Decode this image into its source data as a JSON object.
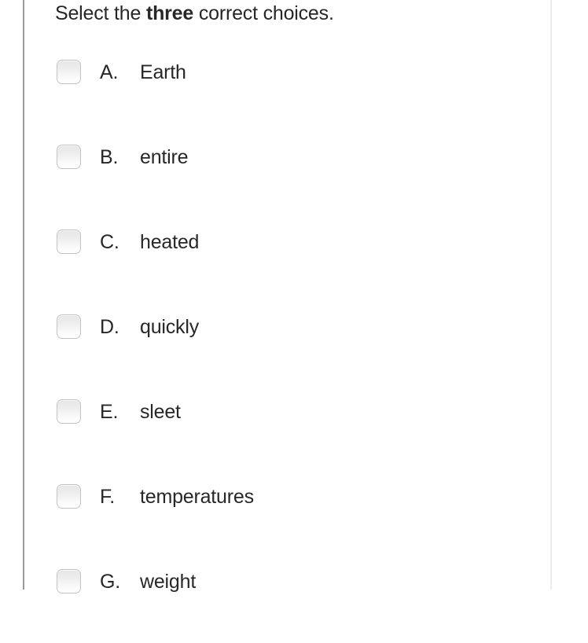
{
  "question": {
    "prompt_before": "Select the ",
    "prompt_emphasis": "three",
    "prompt_after": " correct choices."
  },
  "options": [
    {
      "letter": "A.",
      "label": "Earth",
      "checked": false
    },
    {
      "letter": "B.",
      "label": "entire",
      "checked": false
    },
    {
      "letter": "C.",
      "label": "heated",
      "checked": false
    },
    {
      "letter": "D.",
      "label": "quickly",
      "checked": false
    },
    {
      "letter": "E.",
      "label": "sleet",
      "checked": false
    },
    {
      "letter": "F.",
      "label": "temperatures",
      "checked": false
    },
    {
      "letter": "G.",
      "label": "weight",
      "checked": false
    }
  ],
  "colors": {
    "text": "#272727",
    "rule_left": "#9b9b9b",
    "rule_right": "#ededed",
    "checkbox_border": "#c3c3c3",
    "background": "#ffffff"
  }
}
